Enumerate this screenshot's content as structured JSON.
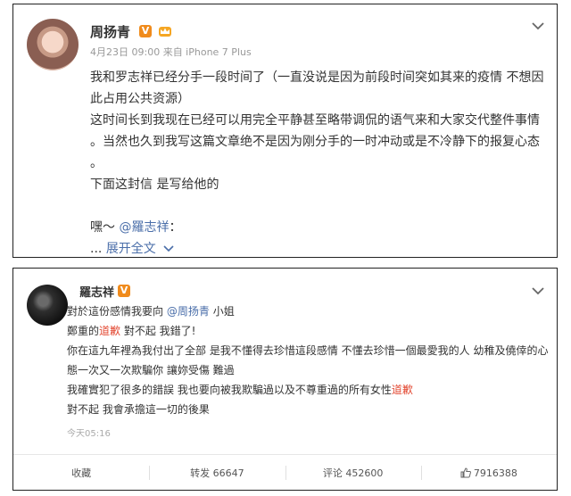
{
  "post1": {
    "username": "周扬青",
    "vbadge": "V",
    "meta": "4月23日 09:00 来自 iPhone 7 Plus",
    "lines": [
      "我和罗志祥已经分手一段时间了（一直没说是因为前段时间突如其来的疫情 不想因此占用公共资源）",
      "这时间长到我现在已经可以用完全平静甚至略带调侃的语气来和大家交代整件事情 。当然也久到我写这篇文章绝不是因为刚分手的一时冲动或是不冷静下的报复心态 。",
      "下面这封信 是写给他的",
      ""
    ],
    "last_line_prefix": "嘿～",
    "last_line_mention": "@羅志祥",
    "last_line_suffix": "：",
    "expand_dots": "...",
    "expand_label": "展开全文",
    "icons": [
      "crown-badge-icon",
      "chevron-down-icon"
    ]
  },
  "post2": {
    "username": "羅志祥",
    "vbadge": "V",
    "line1_prefix": "對於這份感情我要向",
    "line1_mention": "@周扬青",
    "line1_suffix": "小姐",
    "line2_prefix": "鄭重的",
    "line2_red": "道歉",
    "line2_suffix": "對不起 我錯了!",
    "line3": "你在這九年裡為我付出了全部 是我不懂得去珍惜這段感情 不懂去珍惜一個最愛我的人 幼稚及僥倖的心態一次又一次欺騙你 讓妳受傷 難過",
    "line4_prefix": "我確實犯了很多的錯誤 我也要向被我欺騙過以及不尊重過的所有女性",
    "line4_red": "道歉",
    "line5": "對不起 我會承擔這一切的後果",
    "time": "今天05:16",
    "actions": {
      "favorite": "收藏",
      "repost": "转发 66647",
      "comment": "评论 452600",
      "like": "7916388"
    },
    "colors": {
      "accent_red": "#e34b35",
      "mention_blue": "#4a6ea9",
      "vip_orange": "#f08b1c"
    }
  }
}
